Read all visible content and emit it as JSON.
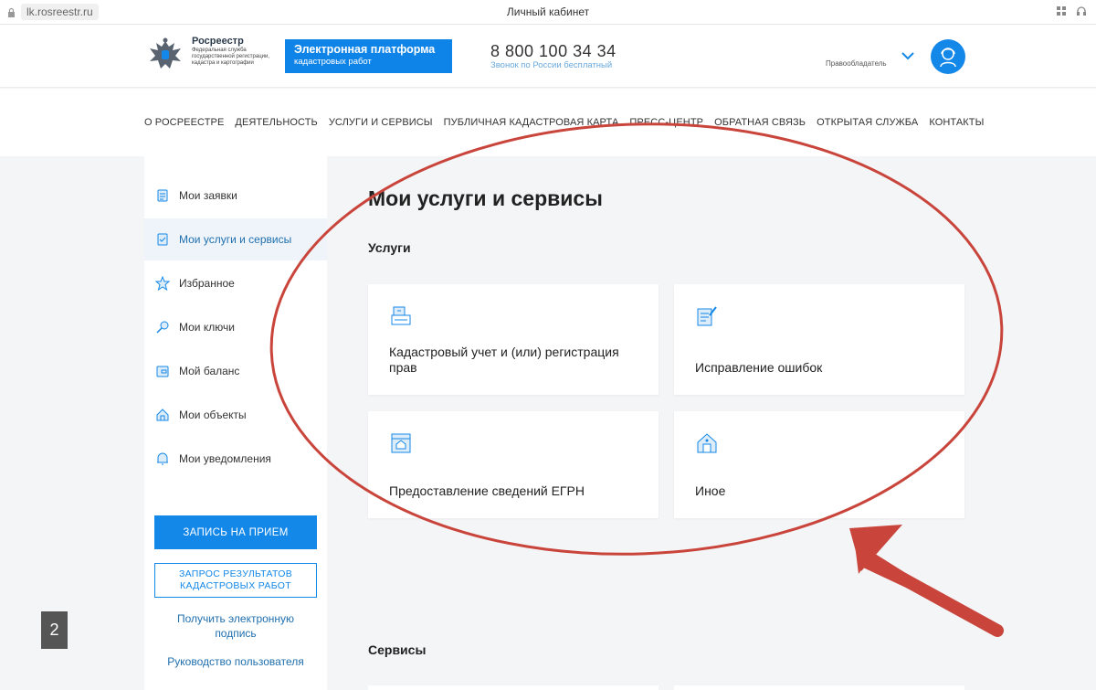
{
  "browser": {
    "url": "lk.rosreestr.ru",
    "window_title": "Личный кабинет"
  },
  "header": {
    "logo_name": "Росреестр",
    "logo_subtitle": "Федеральная служба государственной регистрации, кадастра и картографии",
    "platform_title": "Электронная платформа",
    "platform_subtitle": "кадастровых работ",
    "phone": "8 800 100 34 34",
    "phone_note": "Звонок по России бесплатный",
    "role": "Правообладатель"
  },
  "nav": [
    "О РОСРЕЕСТРЕ",
    "ДЕЯТЕЛЬНОСТЬ",
    "УСЛУГИ И СЕРВИСЫ",
    "ПУБЛИЧНАЯ КАДАСТРОВАЯ КАРТА",
    "ПРЕСС-ЦЕНТР",
    "ОБРАТНАЯ СВЯЗЬ",
    "ОТКРЫТАЯ СЛУЖБА",
    "КОНТАКТЫ"
  ],
  "sidebar": {
    "items": [
      {
        "label": "Мои заявки",
        "icon": "document-icon"
      },
      {
        "label": "Мои услуги и сервисы",
        "icon": "checklist-icon",
        "active": true
      },
      {
        "label": "Избранное",
        "icon": "star-icon"
      },
      {
        "label": "Мои ключи",
        "icon": "key-icon"
      },
      {
        "label": "Мой баланс",
        "icon": "wallet-icon"
      },
      {
        "label": "Мои объекты",
        "icon": "house-icon"
      },
      {
        "label": "Мои уведомления",
        "icon": "bell-icon"
      }
    ],
    "appointment_button": "ЗАПИСЬ НА ПРИЕМ",
    "request_button_line1": "ЗАПРОС РЕЗУЛЬТАТОВ",
    "request_button_line2": "КАДАСТРОВЫХ РАБОТ",
    "signature_link": "Получить электронную подпись",
    "manual_link": "Руководство пользователя"
  },
  "main": {
    "title": "Мои услуги и сервисы",
    "services_heading": "Услуги",
    "cards": [
      {
        "label": "Кадастровый учет и (или) регистрация прав",
        "icon": "cadastre-icon"
      },
      {
        "label": "Исправление ошибок",
        "icon": "edit-document-icon"
      },
      {
        "label": "Предоставление сведений ЕГРН",
        "icon": "register-icon"
      },
      {
        "label": "Иное",
        "icon": "other-house-icon"
      }
    ],
    "tools_heading": "Сервисы"
  },
  "page_number": "2",
  "colors": {
    "brand_blue": "#1488e8",
    "annotation_red": "#c9453c"
  }
}
